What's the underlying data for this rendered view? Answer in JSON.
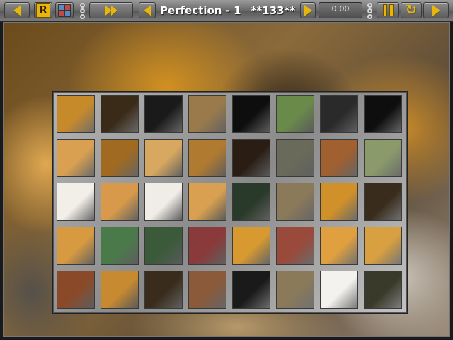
{
  "toolbar": {
    "level_title": "Perfection - 1",
    "move_count": "**133**",
    "timer": "0:00",
    "reset_label": "R",
    "refresh_glyph": "↻"
  },
  "icons": {
    "prev": "prev-arrow-icon",
    "restart": "restart-icon",
    "grid": "grid-view-icon",
    "fast_forward": "fast-forward-icon",
    "pause": "pause-icon",
    "refresh": "refresh-icon",
    "next": "next-arrow-icon"
  },
  "colors": {
    "accent": "#e8b50c",
    "toolbar": "#6e6e6e",
    "board": "#9a9a9a"
  },
  "puzzle": {
    "rows": 5,
    "cols": 8,
    "tiles": [
      [
        "#c78a2a",
        "#3a2a18",
        "#1a1a1a",
        "#9a7a4a",
        "#0e0e0e",
        "#6a8a4a",
        "#2a2a2a",
        "#0e0e0e"
      ],
      [
        "#d8a050",
        "#a06a20",
        "#d8a860",
        "#b07a30",
        "#2a1e14",
        "#6a6a5a",
        "#a06030",
        "#8a9a6a"
      ],
      [
        "#f2eee8",
        "#d89a4a",
        "#f0ece6",
        "#d8a050",
        "#2a3a2a",
        "#8a7a5a",
        "#d0902a",
        "#3a2c1c"
      ],
      [
        "#d89a40",
        "#4a7a4a",
        "#3a5a3a",
        "#8a3a3a",
        "#d89a30",
        "#9a4a3a",
        "#e0a040",
        "#d8a040"
      ],
      [
        "#8a4a2a",
        "#c88a30",
        "#3a2c1c",
        "#8a5a3a",
        "#1a1a1a",
        "#8a7a5a",
        "#f4f2ee",
        "#3a3a2a"
      ]
    ]
  }
}
